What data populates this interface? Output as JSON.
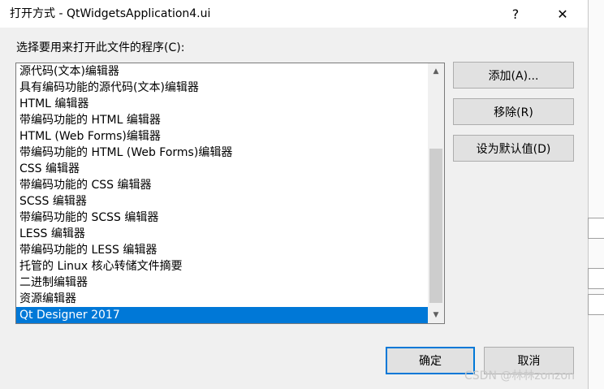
{
  "window": {
    "title": "打开方式 - QtWidgetsApplication4.ui",
    "help_label": "?",
    "close_label": "✕"
  },
  "prompt": "选择要用来打开此文件的程序(C):",
  "programs": [
    "源代码(文本)编辑器",
    "具有编码功能的源代码(文本)编辑器",
    "HTML 编辑器",
    "带编码功能的 HTML 编辑器",
    "HTML (Web Forms)编辑器",
    "带编码功能的 HTML (Web Forms)编辑器",
    "CSS 编辑器",
    "带编码功能的 CSS 编辑器",
    "SCSS 编辑器",
    "带编码功能的 SCSS 编辑器",
    "LESS 编辑器",
    "带编码功能的 LESS 编辑器",
    "托管的 Linux 核心转储文件摘要",
    "二进制编辑器",
    "资源编辑器",
    "Qt Designer 2017"
  ],
  "selected_index": 15,
  "buttons": {
    "add": "添加(A)...",
    "remove": "移除(R)",
    "set_default": "设为默认值(D)",
    "ok": "确定",
    "cancel": "取消"
  },
  "scrollbar": {
    "up_icon": "chevron-up-icon",
    "down_icon": "chevron-down-icon"
  },
  "watermark": "CSDN @林林zonzon"
}
